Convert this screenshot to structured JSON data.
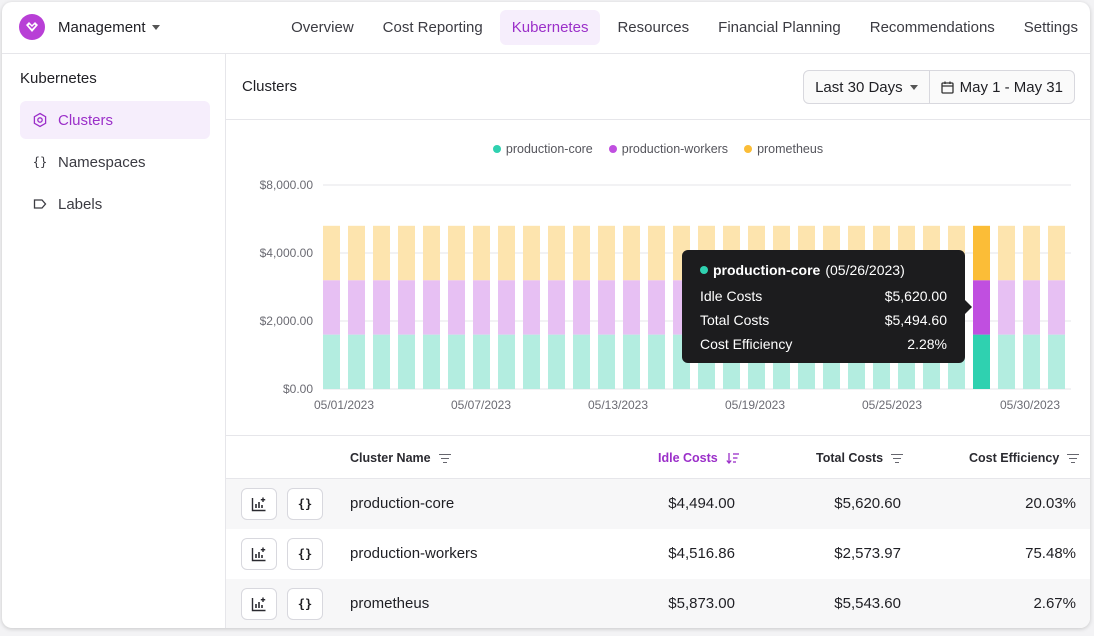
{
  "app": {
    "org_name": "Management",
    "nav": [
      "Overview",
      "Cost Reporting",
      "Kubernetes",
      "Resources",
      "Financial Planning",
      "Recommendations",
      "Settings"
    ],
    "active_nav": "Kubernetes",
    "brand_color": "#b83fd6"
  },
  "sidebar": {
    "title": "Kubernetes",
    "items": [
      {
        "label": "Clusters",
        "icon": "cluster-icon",
        "active": true
      },
      {
        "label": "Namespaces",
        "icon": "braces-icon",
        "active": false
      },
      {
        "label": "Labels",
        "icon": "tag-icon",
        "active": false
      }
    ]
  },
  "main": {
    "title": "Clusters",
    "date_range": "Last 30 Days",
    "date_picker": "May 1 - May 31"
  },
  "chart_data": {
    "type": "bar",
    "stacked": true,
    "legend_position": "top-center",
    "grid": true,
    "y_ticks": [
      "$8,000.00",
      "$4,000.00",
      "$2,000.00",
      "$0.00"
    ],
    "x_ticks": [
      "05/01/2023",
      "05/07/2023",
      "05/13/2023",
      "05/19/2023",
      "05/25/2023",
      "05/30/2023"
    ],
    "categories": [
      "05/01/2023",
      "05/02/2023",
      "05/03/2023",
      "05/04/2023",
      "05/05/2023",
      "05/06/2023",
      "05/07/2023",
      "05/08/2023",
      "05/09/2023",
      "05/10/2023",
      "05/11/2023",
      "05/12/2023",
      "05/13/2023",
      "05/14/2023",
      "05/15/2023",
      "05/16/2023",
      "05/17/2023",
      "05/18/2023",
      "05/19/2023",
      "05/20/2023",
      "05/21/2023",
      "05/22/2023",
      "05/23/2023",
      "05/24/2023",
      "05/25/2023",
      "05/26/2023",
      "05/27/2023",
      "05/28/2023",
      "05/29/2023",
      "05/30/2023"
    ],
    "highlight_index": 26,
    "series": [
      {
        "name": "production-core",
        "color": "#2fd1b0",
        "light": "#b3ede0",
        "values": [
          1600,
          1600,
          1600,
          1600,
          1600,
          1600,
          1600,
          1600,
          1600,
          1600,
          1600,
          1600,
          1600,
          1600,
          1600,
          1600,
          1600,
          1600,
          1600,
          1600,
          1600,
          1600,
          1600,
          1600,
          1600,
          1600,
          1600,
          1600,
          1600,
          1600
        ]
      },
      {
        "name": "production-workers",
        "color": "#c04fe0",
        "light": "#e7c0f3",
        "values": [
          1600,
          1600,
          1600,
          1600,
          1600,
          1600,
          1600,
          1600,
          1600,
          1600,
          1600,
          1600,
          1600,
          1600,
          1600,
          1600,
          1600,
          1600,
          1600,
          1600,
          1600,
          1600,
          1600,
          1600,
          1600,
          1600,
          1600,
          1600,
          1600,
          1600
        ]
      },
      {
        "name": "prometheus",
        "color": "#fbbd37",
        "light": "#fde4ae",
        "values": [
          1600,
          1600,
          1600,
          1600,
          1600,
          1600,
          1600,
          1600,
          1600,
          1600,
          1600,
          1600,
          1600,
          1600,
          1600,
          1600,
          1600,
          1600,
          1600,
          1600,
          1600,
          1600,
          1600,
          1600,
          1600,
          1600,
          1600,
          1600,
          1600,
          1600
        ]
      }
    ],
    "tooltip": {
      "series": "production-core",
      "date": "(05/26/2023)",
      "rows": [
        {
          "label": "Idle Costs",
          "value": "$5,620.00"
        },
        {
          "label": "Total Costs",
          "value": "$5,494.60"
        },
        {
          "label": "Cost Efficiency",
          "value": "2.28%"
        }
      ]
    }
  },
  "table": {
    "columns": [
      "Cluster Name",
      "Idle Costs",
      "Total Costs",
      "Cost Efficiency"
    ],
    "sorted_column": "Idle Costs",
    "rows": [
      {
        "name": "production-core",
        "idle": "$4,494.00",
        "total": "$5,620.60",
        "efficiency": "20.03%"
      },
      {
        "name": "production-workers",
        "idle": "$4,516.86",
        "total": "$2,573.97",
        "efficiency": "75.48%"
      },
      {
        "name": "prometheus",
        "idle": "$5,873.00",
        "total": "$5,543.60",
        "efficiency": "2.67%"
      }
    ]
  }
}
